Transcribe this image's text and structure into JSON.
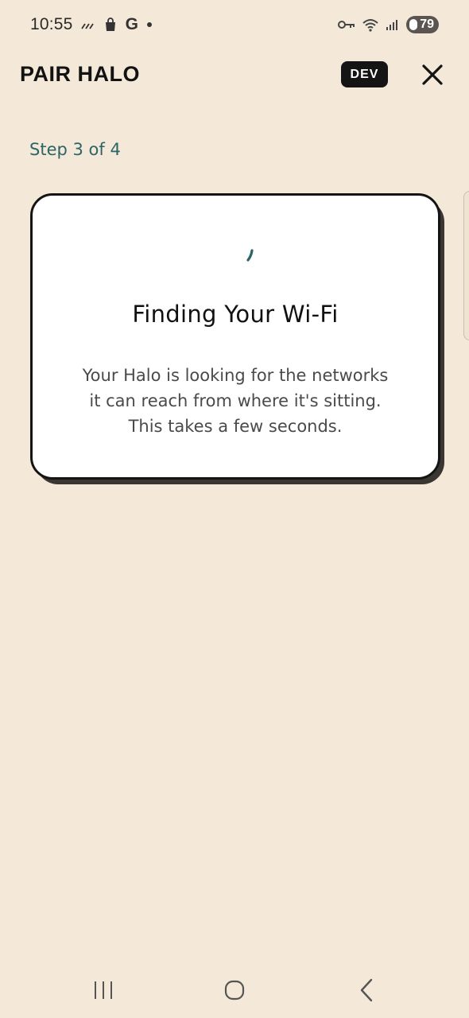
{
  "status_bar": {
    "time": "10:55",
    "carrier_letter": "G",
    "battery_level": "79",
    "icons": [
      "signal-slash-icon",
      "bag-icon",
      "google-icon",
      "notification-dot-icon",
      "vpn-key-icon",
      "wifi-icon",
      "cell-signal-icon",
      "battery-icon"
    ]
  },
  "header": {
    "title": "PAIR HALO",
    "badge": "DEV",
    "close_icon": "close-icon"
  },
  "step": {
    "label": "Step 3 of 4"
  },
  "card": {
    "spinner_icon": "loading-spinner-icon",
    "title": "Finding Your Wi-Fi",
    "body": "Your Halo is looking for the networks\nit can reach from where it's sitting.\nThis takes a few seconds."
  },
  "nav_bar": {
    "icons": [
      "recent-apps-icon",
      "home-icon",
      "back-icon"
    ]
  },
  "colors": {
    "background": "#f4e9d8",
    "accent_teal": "#2c6467",
    "card_border": "#141414",
    "badge_bg": "#141414"
  }
}
